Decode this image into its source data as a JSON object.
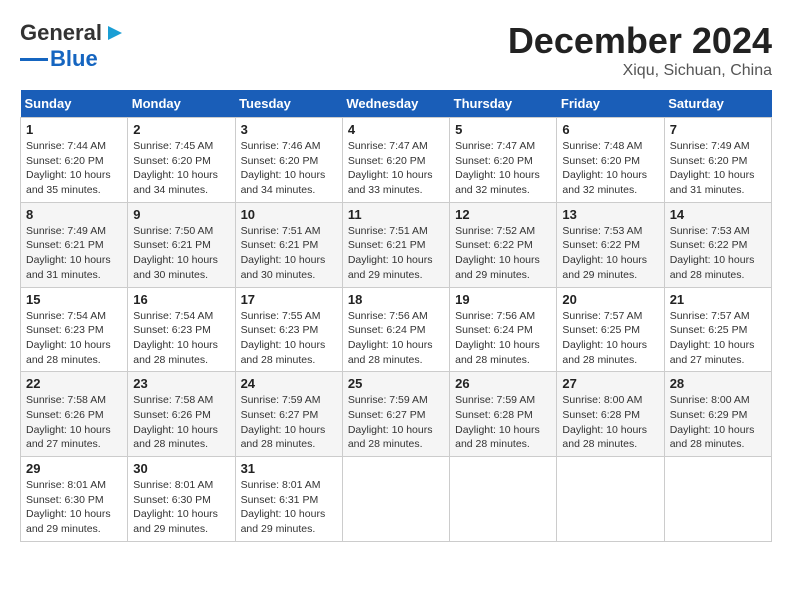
{
  "header": {
    "logo_general": "General",
    "logo_blue": "Blue",
    "month": "December 2024",
    "location": "Xiqu, Sichuan, China"
  },
  "days_of_week": [
    "Sunday",
    "Monday",
    "Tuesday",
    "Wednesday",
    "Thursday",
    "Friday",
    "Saturday"
  ],
  "weeks": [
    [
      {
        "day": "1",
        "sunrise": "Sunrise: 7:44 AM",
        "sunset": "Sunset: 6:20 PM",
        "daylight": "Daylight: 10 hours and 35 minutes."
      },
      {
        "day": "2",
        "sunrise": "Sunrise: 7:45 AM",
        "sunset": "Sunset: 6:20 PM",
        "daylight": "Daylight: 10 hours and 34 minutes."
      },
      {
        "day": "3",
        "sunrise": "Sunrise: 7:46 AM",
        "sunset": "Sunset: 6:20 PM",
        "daylight": "Daylight: 10 hours and 34 minutes."
      },
      {
        "day": "4",
        "sunrise": "Sunrise: 7:47 AM",
        "sunset": "Sunset: 6:20 PM",
        "daylight": "Daylight: 10 hours and 33 minutes."
      },
      {
        "day": "5",
        "sunrise": "Sunrise: 7:47 AM",
        "sunset": "Sunset: 6:20 PM",
        "daylight": "Daylight: 10 hours and 32 minutes."
      },
      {
        "day": "6",
        "sunrise": "Sunrise: 7:48 AM",
        "sunset": "Sunset: 6:20 PM",
        "daylight": "Daylight: 10 hours and 32 minutes."
      },
      {
        "day": "7",
        "sunrise": "Sunrise: 7:49 AM",
        "sunset": "Sunset: 6:20 PM",
        "daylight": "Daylight: 10 hours and 31 minutes."
      }
    ],
    [
      {
        "day": "8",
        "sunrise": "Sunrise: 7:49 AM",
        "sunset": "Sunset: 6:21 PM",
        "daylight": "Daylight: 10 hours and 31 minutes."
      },
      {
        "day": "9",
        "sunrise": "Sunrise: 7:50 AM",
        "sunset": "Sunset: 6:21 PM",
        "daylight": "Daylight: 10 hours and 30 minutes."
      },
      {
        "day": "10",
        "sunrise": "Sunrise: 7:51 AM",
        "sunset": "Sunset: 6:21 PM",
        "daylight": "Daylight: 10 hours and 30 minutes."
      },
      {
        "day": "11",
        "sunrise": "Sunrise: 7:51 AM",
        "sunset": "Sunset: 6:21 PM",
        "daylight": "Daylight: 10 hours and 29 minutes."
      },
      {
        "day": "12",
        "sunrise": "Sunrise: 7:52 AM",
        "sunset": "Sunset: 6:22 PM",
        "daylight": "Daylight: 10 hours and 29 minutes."
      },
      {
        "day": "13",
        "sunrise": "Sunrise: 7:53 AM",
        "sunset": "Sunset: 6:22 PM",
        "daylight": "Daylight: 10 hours and 29 minutes."
      },
      {
        "day": "14",
        "sunrise": "Sunrise: 7:53 AM",
        "sunset": "Sunset: 6:22 PM",
        "daylight": "Daylight: 10 hours and 28 minutes."
      }
    ],
    [
      {
        "day": "15",
        "sunrise": "Sunrise: 7:54 AM",
        "sunset": "Sunset: 6:23 PM",
        "daylight": "Daylight: 10 hours and 28 minutes."
      },
      {
        "day": "16",
        "sunrise": "Sunrise: 7:54 AM",
        "sunset": "Sunset: 6:23 PM",
        "daylight": "Daylight: 10 hours and 28 minutes."
      },
      {
        "day": "17",
        "sunrise": "Sunrise: 7:55 AM",
        "sunset": "Sunset: 6:23 PM",
        "daylight": "Daylight: 10 hours and 28 minutes."
      },
      {
        "day": "18",
        "sunrise": "Sunrise: 7:56 AM",
        "sunset": "Sunset: 6:24 PM",
        "daylight": "Daylight: 10 hours and 28 minutes."
      },
      {
        "day": "19",
        "sunrise": "Sunrise: 7:56 AM",
        "sunset": "Sunset: 6:24 PM",
        "daylight": "Daylight: 10 hours and 28 minutes."
      },
      {
        "day": "20",
        "sunrise": "Sunrise: 7:57 AM",
        "sunset": "Sunset: 6:25 PM",
        "daylight": "Daylight: 10 hours and 28 minutes."
      },
      {
        "day": "21",
        "sunrise": "Sunrise: 7:57 AM",
        "sunset": "Sunset: 6:25 PM",
        "daylight": "Daylight: 10 hours and 27 minutes."
      }
    ],
    [
      {
        "day": "22",
        "sunrise": "Sunrise: 7:58 AM",
        "sunset": "Sunset: 6:26 PM",
        "daylight": "Daylight: 10 hours and 27 minutes."
      },
      {
        "day": "23",
        "sunrise": "Sunrise: 7:58 AM",
        "sunset": "Sunset: 6:26 PM",
        "daylight": "Daylight: 10 hours and 28 minutes."
      },
      {
        "day": "24",
        "sunrise": "Sunrise: 7:59 AM",
        "sunset": "Sunset: 6:27 PM",
        "daylight": "Daylight: 10 hours and 28 minutes."
      },
      {
        "day": "25",
        "sunrise": "Sunrise: 7:59 AM",
        "sunset": "Sunset: 6:27 PM",
        "daylight": "Daylight: 10 hours and 28 minutes."
      },
      {
        "day": "26",
        "sunrise": "Sunrise: 7:59 AM",
        "sunset": "Sunset: 6:28 PM",
        "daylight": "Daylight: 10 hours and 28 minutes."
      },
      {
        "day": "27",
        "sunrise": "Sunrise: 8:00 AM",
        "sunset": "Sunset: 6:28 PM",
        "daylight": "Daylight: 10 hours and 28 minutes."
      },
      {
        "day": "28",
        "sunrise": "Sunrise: 8:00 AM",
        "sunset": "Sunset: 6:29 PM",
        "daylight": "Daylight: 10 hours and 28 minutes."
      }
    ],
    [
      {
        "day": "29",
        "sunrise": "Sunrise: 8:01 AM",
        "sunset": "Sunset: 6:30 PM",
        "daylight": "Daylight: 10 hours and 29 minutes."
      },
      {
        "day": "30",
        "sunrise": "Sunrise: 8:01 AM",
        "sunset": "Sunset: 6:30 PM",
        "daylight": "Daylight: 10 hours and 29 minutes."
      },
      {
        "day": "31",
        "sunrise": "Sunrise: 8:01 AM",
        "sunset": "Sunset: 6:31 PM",
        "daylight": "Daylight: 10 hours and 29 minutes."
      },
      null,
      null,
      null,
      null
    ]
  ]
}
